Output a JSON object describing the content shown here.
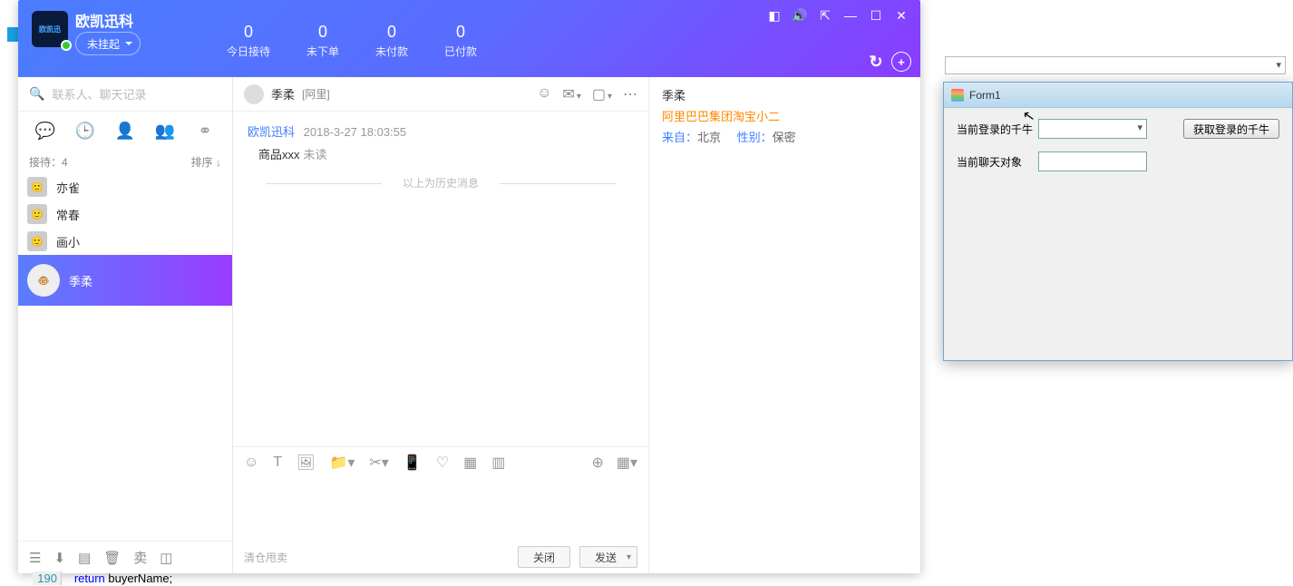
{
  "app": {
    "title": "欧凯迅科",
    "status": "未挂起",
    "logo_text": "欧凯迅"
  },
  "stats": [
    {
      "num": "0",
      "label": "今日接待"
    },
    {
      "num": "0",
      "label": "未下单"
    },
    {
      "num": "0",
      "label": "未付款"
    },
    {
      "num": "0",
      "label": "已付款"
    }
  ],
  "search_placeholder": "联系人、聊天记录",
  "list_header": {
    "left": "接待：4",
    "right": "排序 ↓"
  },
  "contacts": [
    {
      "name": "亦雀"
    },
    {
      "name": "常春"
    },
    {
      "name": "画小"
    },
    {
      "name": "季柔"
    }
  ],
  "chat": {
    "name": "季柔",
    "sub": "[阿里]",
    "meta_sender": "欧凯迅科",
    "meta_time": "2018-3-27 18:03:55",
    "body": "商品xxx",
    "body_status": "未读",
    "divider": "以上为历史消息",
    "clear_link": "清仓甩卖",
    "btn_close": "关闭",
    "btn_send": "发送"
  },
  "info": {
    "name": "季柔",
    "org": "阿里巴巴集团淘宝小二",
    "from_label": "来自：",
    "from_val": "北京",
    "gender_label": "性别：",
    "gender_val": "保密"
  },
  "form1": {
    "title": "Form1",
    "label1": "当前登录的千牛",
    "label2": "当前聊天对象",
    "btn": "获取登录的千牛"
  },
  "code": {
    "line_no": "190",
    "kw": "return",
    "ident": " buyerName;"
  }
}
